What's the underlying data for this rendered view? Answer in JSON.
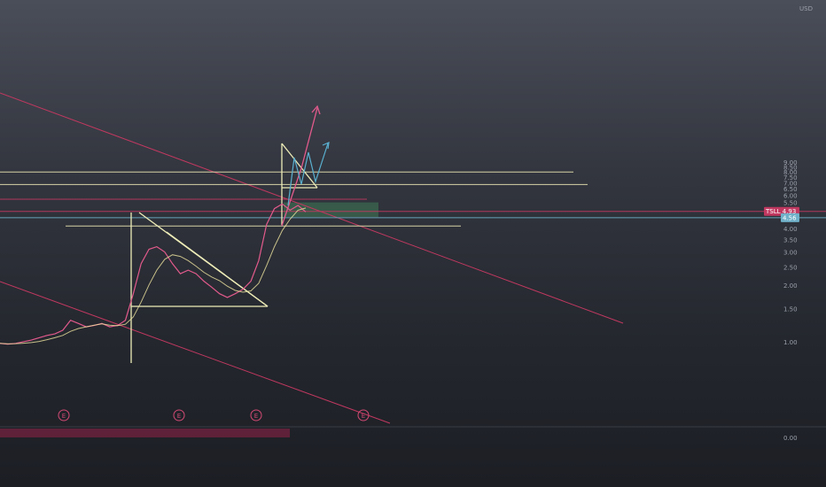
{
  "chart_data": {
    "type": "line",
    "currency": "USD",
    "y_scale": "log",
    "ylim": [
      0.8,
      10
    ],
    "y_ticks": [
      "9.00",
      "8.50",
      "8.00",
      "7.50",
      "7.00",
      "6.50",
      "6.00",
      "5.50",
      "5.00",
      "4.50",
      "4.00",
      "3.50",
      "3.00",
      "2.50",
      "2.00",
      "1.50",
      "1.00"
    ],
    "volume_tick": "0.00",
    "price_series": [
      0.98,
      0.97,
      0.98,
      1.0,
      1.02,
      1.05,
      1.08,
      1.1,
      1.15,
      1.3,
      1.25,
      1.2,
      1.22,
      1.25,
      1.2,
      1.22,
      1.3,
      1.8,
      2.6,
      3.1,
      3.2,
      3.0,
      2.6,
      2.3,
      2.4,
      2.3,
      2.1,
      1.95,
      1.8,
      1.72,
      1.8,
      1.9,
      2.1,
      2.7,
      4.2,
      5.1,
      5.4,
      5.0,
      5.3,
      4.9
    ],
    "price_labels": [
      {
        "text": "TSLL",
        "value": "4.93",
        "color": "#c03860"
      },
      {
        "text": "",
        "value": "4.56",
        "color": "#6fb0c8"
      }
    ],
    "earnings_markers": [
      "E",
      "E",
      "E",
      "E"
    ],
    "horizontal_levels": [
      {
        "price": 7.98,
        "color": "#e8e4b0"
      },
      {
        "price": 6.85,
        "color": "#e8e4b0"
      },
      {
        "price": 5.72,
        "color": "#c03860"
      },
      {
        "price": 4.93,
        "color": "#c03860"
      },
      {
        "price": 4.56,
        "color": "#6fb0c8"
      },
      {
        "price": 4.12,
        "color": "#e8e4b0"
      }
    ],
    "grid": false
  },
  "colors": {
    "price_line": "#e25a8c",
    "ma_short": "#e25a8c",
    "ma_long": "#f0e6a0",
    "pattern_lines": "#eeedb8",
    "trend_lines": "#c03860",
    "zone_fill": "#3f7a55",
    "projection_pink": "#e25a8c",
    "projection_blue": "#5ab0d0"
  }
}
